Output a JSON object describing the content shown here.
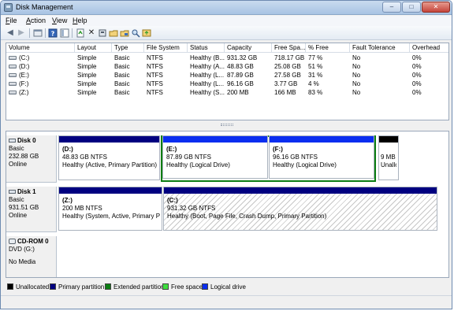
{
  "window": {
    "title": "Disk Management"
  },
  "menu": [
    {
      "label": "File",
      "acc": "F",
      "rest": "ile"
    },
    {
      "label": "Action",
      "acc": "A",
      "rest": "ction"
    },
    {
      "label": "View",
      "acc": "V",
      "rest": "iew"
    },
    {
      "label": "Help",
      "acc": "H",
      "rest": "elp"
    }
  ],
  "toolbar": {
    "back_icon": "back-arrow-icon",
    "forward_icon": "forward-arrow-icon",
    "up_icon": "up-level-icon",
    "properties_icon": "properties-icon",
    "help_icon": "help-icon",
    "console_icon": "show-hide-console-icon",
    "refresh_icon": "refresh-icon",
    "delete_icon": "delete-icon",
    "check_icon": "check-icon",
    "open_icon": "open-icon",
    "explore_icon": "explore-icon",
    "search_icon": "search-icon",
    "rescan_icon": "rescan-icon"
  },
  "volume_list": {
    "columns": [
      "Volume",
      "Layout",
      "Type",
      "File System",
      "Status",
      "Capacity",
      "Free Spa...",
      "% Free",
      "Fault Tolerance",
      "Overhead"
    ],
    "rows": [
      [
        "(C:)",
        "Simple",
        "Basic",
        "NTFS",
        "Healthy (B...",
        "931.32 GB",
        "718.17 GB",
        "77 %",
        "No",
        "0%"
      ],
      [
        "(D:)",
        "Simple",
        "Basic",
        "NTFS",
        "Healthy (A...",
        "48.83 GB",
        "25.08 GB",
        "51 %",
        "No",
        "0%"
      ],
      [
        "(E:)",
        "Simple",
        "Basic",
        "NTFS",
        "Healthy (L...",
        "87.89 GB",
        "27.58 GB",
        "31 %",
        "No",
        "0%"
      ],
      [
        "(F:)",
        "Simple",
        "Basic",
        "NTFS",
        "Healthy (L...",
        "96.16 GB",
        "3.77 GB",
        "4 %",
        "No",
        "0%"
      ],
      [
        "(Z:)",
        "Simple",
        "Basic",
        "NTFS",
        "Healthy (S...",
        "200 MB",
        "166 MB",
        "83 %",
        "No",
        "0%"
      ]
    ]
  },
  "disks": {
    "disk0": {
      "name": "Disk 0",
      "type": "Basic",
      "size": "232.88 GB",
      "state": "Online",
      "d": {
        "label": "(D:)",
        "size": "48.83 GB NTFS",
        "status": "Healthy (Active, Primary Partition)"
      },
      "e": {
        "label": "(E:)",
        "size": "87.89 GB NTFS",
        "status": "Healthy (Logical Drive)"
      },
      "f": {
        "label": "(F:)",
        "size": "96.16 GB NTFS",
        "status": "Healthy (Logical Drive)"
      },
      "un": {
        "size": "9 MB",
        "status": "Unallo"
      }
    },
    "disk1": {
      "name": "Disk 1",
      "type": "Basic",
      "size": "931.51 GB",
      "state": "Online",
      "z": {
        "label": "(Z:)",
        "size": "200 MB NTFS",
        "status": "Healthy (System, Active, Primary Part"
      },
      "c": {
        "label": "(C:)",
        "size": "931.32 GB NTFS",
        "status": "Healthy (Boot, Page File, Crash Dump, Primary Partition)"
      }
    },
    "cdrom": {
      "name": "CD-ROM 0",
      "drive": "DVD (G:)",
      "media": "No Media"
    }
  },
  "legend": [
    {
      "label": "Unallocated",
      "color": "#000000"
    },
    {
      "label": "Primary partition",
      "color": "#000080"
    },
    {
      "label": "Extended partition",
      "color": "#0a7d12"
    },
    {
      "label": "Free space",
      "color": "#3dde3d"
    },
    {
      "label": "Logical drive",
      "color": "#0a2ef0"
    }
  ],
  "colors": {
    "primary": "#000080",
    "logical": "#0a2ef0",
    "unallocated": "#000000",
    "extended": "#0a7d12"
  }
}
